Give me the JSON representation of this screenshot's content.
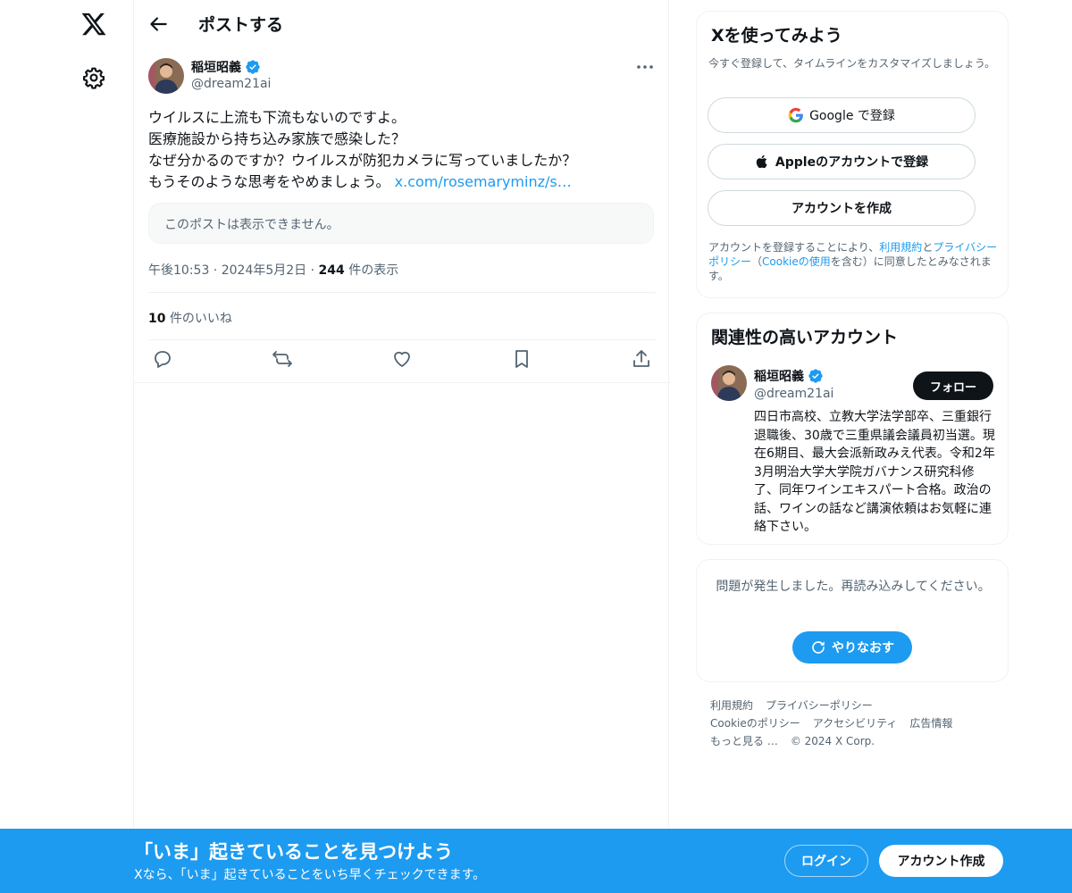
{
  "header": {
    "title": "ポストする"
  },
  "tweet": {
    "author_name": "稲垣昭義",
    "author_handle": "@dream21ai",
    "lines": [
      "ウイルスに上流も下流もないのですよ。",
      "医療施設から持ち込み家族で感染した？",
      "なぜ分かるのですか？ウイルスが防犯カメラに写っていましたか？",
      "もうそのような思考をやめましょう。"
    ],
    "link": "x.com/rosemaryminz/s…",
    "quote_unavailable": "このポストは表示できません。",
    "time": "午後10:53",
    "date": "2024年5月2日",
    "views_count": "244",
    "views_label": "件の表示",
    "likes_count": "10",
    "likes_label": "件のいいね"
  },
  "signup_card": {
    "title": "Xを使ってみよう",
    "subtitle": "今すぐ登録して、タイムラインをカスタマイズしましょう。",
    "google_label": "Google で登録",
    "apple_label": "Appleのアカウントで登録",
    "create_label": "アカウントを作成",
    "legal_prefix": "アカウントを登録することにより、",
    "legal_terms": "利用規約",
    "legal_and": "と",
    "legal_privacy": "プライバシーポリシー",
    "legal_mid": "（",
    "legal_cookie": "Cookieの使用",
    "legal_suffix": "を含む）に同意したとみなされます。"
  },
  "related_card": {
    "title": "関連性の高いアカウント",
    "name": "稲垣昭義",
    "handle": "@dream21ai",
    "follow_label": "フォロー",
    "bio": "四日市高校、立教大学法学部卒、三重銀行退職後、30歳で三重県議会議員初当選。現在6期目、最大会派新政みえ代表。令和2年3月明治大学大学院ガバナンス研究科修了、同年ワインエキスパート合格。政治の話、ワインの話など講演依頼はお気軽に連絡下さい。"
  },
  "error_card": {
    "message": "問題が発生しました。再読み込みしてください。",
    "retry_label": "やりなおす"
  },
  "footer": {
    "row1": [
      "利用規約",
      "プライバシーポリシー"
    ],
    "row2": [
      "Cookieのポリシー",
      "アクセシビリティ",
      "広告情報"
    ],
    "row3": [
      "もっと見る …",
      "© 2024 X Corp."
    ]
  },
  "banner": {
    "title": "「いま」起きていることを見つけよう",
    "subtitle": "Xなら、「いま」起きていることをいち早くチェックできます。",
    "login_label": "ログイン",
    "signup_label": "アカウント作成"
  },
  "colors": {
    "accent": "#1d9bf0",
    "text": "#0f1419",
    "muted": "#536471",
    "border": "#eff3f4"
  },
  "icons": [
    "x-logo-icon",
    "gear-icon",
    "back-arrow-icon",
    "verified-icon",
    "more-icon",
    "reply-icon",
    "repost-icon",
    "like-icon",
    "bookmark-icon",
    "share-icon",
    "google-icon",
    "apple-icon",
    "refresh-icon"
  ]
}
